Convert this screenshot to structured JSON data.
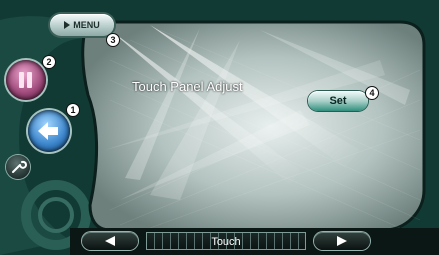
{
  "screen": {
    "title": "Touch Panel Adjust",
    "menu_label": "MENU",
    "set_label": "Set",
    "bottom_label": "Touch",
    "callouts": [
      "1",
      "2",
      "3",
      "4"
    ]
  },
  "icons": {
    "menu": "play-triangle-icon",
    "source": "pause-bars-icon",
    "back": "return-arrow-icon",
    "setup": "wrench-icon",
    "prev": "left-arrow-icon",
    "next": "right-arrow-icon"
  },
  "colors": {
    "panel": "#c9d8d6",
    "background": "#0d2a26",
    "set_button": "#2f8f7c",
    "source_button": "#a04b7c",
    "back_button": "#3c86cc"
  }
}
